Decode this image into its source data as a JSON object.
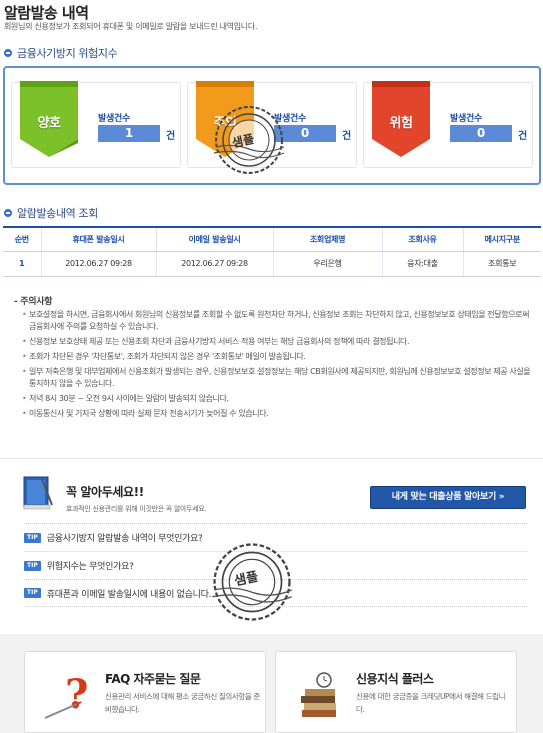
{
  "header": {
    "title": "알람발송 내역",
    "description": "회원님의 신용정보가 조회되어 휴대폰 및 이메일로 알람을 보내드린 내역입니다."
  },
  "risk_section": {
    "heading": "금융사기방지 위험지수",
    "cards": [
      {
        "status": "양호",
        "count_label": "발생건수",
        "count": "1",
        "unit": "건",
        "color": "#7cc12a"
      },
      {
        "status": "주의",
        "count_label": "발생건수",
        "count": "0",
        "unit": "건",
        "color": "#f19a1b"
      },
      {
        "status": "위험",
        "count_label": "발생건수",
        "count": "0",
        "unit": "건",
        "color": "#e2452b"
      }
    ]
  },
  "history_section": {
    "heading": "알람발송내역 조회",
    "columns": [
      "순번",
      "휴대폰 발송일시",
      "이메일 발송일시",
      "조회업체명",
      "조회사유",
      "메시지구분"
    ],
    "rows": [
      [
        "1",
        "2012.06.27 09:28",
        "2012.06.27 09:28",
        "우리은행",
        "융자:대출",
        "조회통보"
      ]
    ]
  },
  "notice": {
    "title": "- 주의사항",
    "items": [
      "보호설정을 하시면, 금융회사에서 회원님의 신용정보를 조회할 수 없도록 원천차단 하거나, 신용정보 조회는 차단하지 않고, 신용정보보호 상태임을 전달함으로써 금융회사에 주의를 요청하실 수 있습니다.",
      "신용정보 보호상태 제공 또는 신용조회 차단과 금융사기방지 서비스 적용 여부는 해당 금융회사의 정책에 따라 결정됩니다.",
      "조회가 차단된 경우 '차단통보', 조회가 차단되지 않은 경우 '조회통보' 메일이 발송됩니다.",
      "일부 저축은행 및 대부업체에서 신용조회가 발생되는 경우, 신용정보보호 설정정보는 해당 CB회원사에 제공되지만, 회원님께 신용정보보호 설정정보 제공 사실을 통지하지 않을 수 있습니다.",
      "저녁 8시 30분 ~ 오전 9시 사이에는 알람이 발송되지 않습니다.",
      "이동통신사 및 기지국 상황에 따라 실제 문자 전송시기가 늦어질 수 있습니다."
    ]
  },
  "tips": {
    "heading": "꼭 알아두세요!!",
    "subheading": "효과적인 신용관리를 위해 이것만은 꼭 알아두세요.",
    "button": "내게 맞는 대출상품 알아보기 »",
    "badge": "TIP",
    "items": [
      "금융사기방지 알람발송 내역이 무엇인가요?",
      "위험지수는 무엇인가요?",
      "휴대폰과 이메일 발송일시에 내용이 없습니다."
    ]
  },
  "promos": [
    {
      "title": "FAQ 자주묻는 질문",
      "desc": "신용관리 서비스에 대해 평소 궁금하신 질의사항을 준비했습니다.",
      "icon": "question-icon"
    },
    {
      "title": "신용지식 플러스",
      "desc": "신용에 대한 궁금증을 크레딧UP에서 해결해 드립니다.",
      "icon": "books-icon"
    }
  ],
  "stamps": {
    "text": "샘플"
  }
}
